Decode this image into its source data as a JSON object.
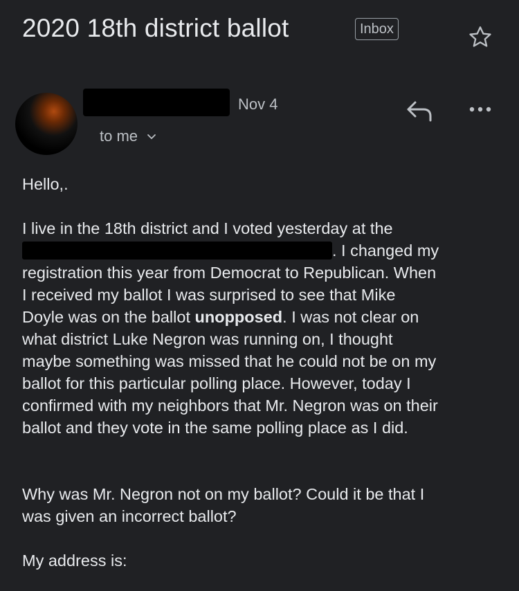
{
  "email": {
    "subject": "2020 18th district ballot",
    "label": "Inbox",
    "date": "Nov 4",
    "recipient": "to me",
    "greeting": "Hello,.",
    "para1": {
      "line1": "I live in the 18th district and I voted yesterday at the",
      "line2_after_redaction": ".  I changed my",
      "line3": "registration this year from Democrat to Republican.  When",
      "line4": "I received my ballot I was surprised to see that Mike",
      "line5_before_bold": "Doyle was on the ballot ",
      "line5_bold": "unopposed",
      "line5_after_bold": ".  I was not clear on",
      "line6": "what district Luke Negron was running on, I thought",
      "line7": "maybe something was missed that he could not be on my",
      "line8": "ballot for this particular polling place.  However, today I",
      "line9": "confirmed with my neighbors that Mr. Negron was on their",
      "line10": "ballot and they vote in the same polling place as I did."
    },
    "para2": {
      "line1": "Why was Mr. Negron not on my ballot? Could it be that I",
      "line2": "was given an incorrect ballot?"
    },
    "para3": "My address is:"
  },
  "icons": {
    "star": "star-outline-icon",
    "reply": "reply-icon",
    "more": "more-horizontal-icon",
    "chevron": "chevron-down-icon"
  },
  "colors": {
    "background": "#202124",
    "text": "#e8eaed",
    "secondary_text": "#bdc1c6"
  }
}
